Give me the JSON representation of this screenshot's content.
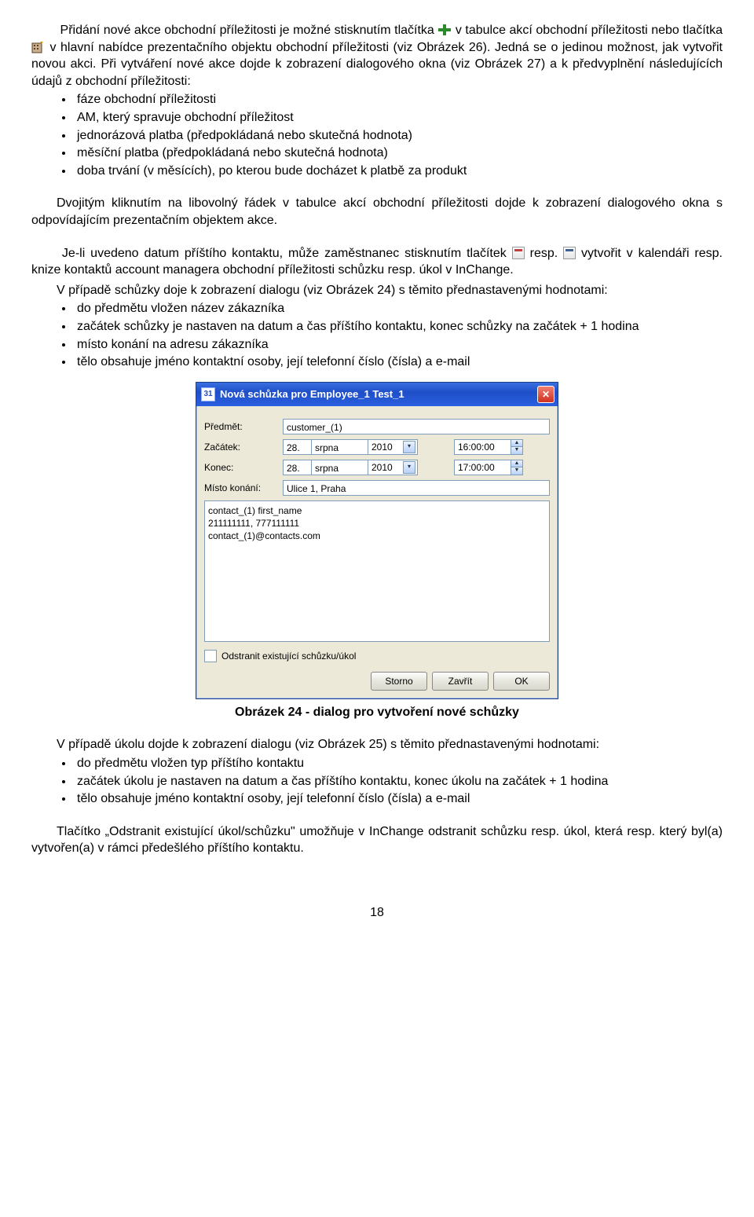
{
  "para1": {
    "a": "Přidání nové akce obchodní příležitosti je možné stisknutím tlačítka ",
    "b": " v tabulce akcí obchodní příležitosti nebo tlačítka ",
    "c": " v hlavní nabídce prezentačního objektu obchodní příležitosti (viz Obrázek 26). Jedná se o jedinou možnost, jak vytvořit novou akci. Při vytváření nové akce dojde k zobrazení dialogového okna (viz Obrázek 27) a k předvyplnění následujících údajů z obchodní příležitosti:"
  },
  "list1": [
    "fáze obchodní příležitosti",
    "AM, který spravuje obchodní příležitost",
    "jednorázová platba (předpokládaná nebo skutečná hodnota)",
    "měsíční platba (předpokládaná nebo skutečná hodnota)",
    "doba trvání (v měsících), po kterou bude docházet k platbě za produkt"
  ],
  "para2": "Dvojitým kliknutím na libovolný řádek v tabulce akcí obchodní příležitosti dojde k zobrazení dialogového okna s odpovídajícím prezentačním objektem akce.",
  "para3": {
    "a": "Je-li uvedeno datum příštího kontaktu, může zaměstnanec stisknutím tlačítek ",
    "b": " resp. ",
    "c": " vytvořit v kalendáři resp. knize kontaktů account managera obchodní příležitosti schůzku resp. úkol v InChange."
  },
  "para4": "V případě schůzky doje k zobrazení dialogu (viz Obrázek 24) s těmito přednastavenými hodnotami:",
  "list2": [
    "do předmětu vložen název zákazníka",
    "začátek schůzky je nastaven na datum a čas příštího kontaktu, konec schůzky na začátek + 1 hodina",
    "místo konání na adresu zákazníka",
    "tělo obsahuje jméno kontaktní osoby, její telefonní číslo (čísla) a e-mail"
  ],
  "dialog": {
    "icon_text": "31",
    "title": "Nová schůzka pro Employee_1 Test_1",
    "labels": {
      "subject": "Předmět:",
      "start": "Začátek:",
      "end": "Konec:",
      "place": "Místo konání:"
    },
    "subject_value": "customer_(1)",
    "start": {
      "day": "28.",
      "month": "srpna",
      "year": "2010",
      "time": "16:00:00"
    },
    "end": {
      "day": "28.",
      "month": "srpna",
      "year": "2010",
      "time": "17:00:00"
    },
    "place_value": "Ulice 1, Praha",
    "body": "contact_(1) first_name\n211111111, 777111111\ncontact_(1)@contacts.com",
    "checkbox": "Odstranit existující schůzku/úkol",
    "buttons": {
      "storno": "Storno",
      "close": "Zavřít",
      "ok": "OK"
    }
  },
  "caption": "Obrázek 24 - dialog pro vytvoření nové schůzky",
  "para5": "V případě úkolu dojde k zobrazení dialogu (viz Obrázek 25) s těmito přednastavenými hodnotami:",
  "list3": [
    "do předmětu vložen typ příštího kontaktu",
    "začátek úkolu je nastaven na datum a čas příštího kontaktu, konec úkolu na začátek + 1 hodina",
    "tělo obsahuje jméno kontaktní osoby, její telefonní číslo (čísla) a e-mail"
  ],
  "para6": "Tlačítko „Odstranit existující úkol/schůzku\" umožňuje v InChange odstranit schůzku resp. úkol, která resp. který byl(a) vytvořen(a) v rámci předešlého příštího kontaktu.",
  "page_number": "18"
}
